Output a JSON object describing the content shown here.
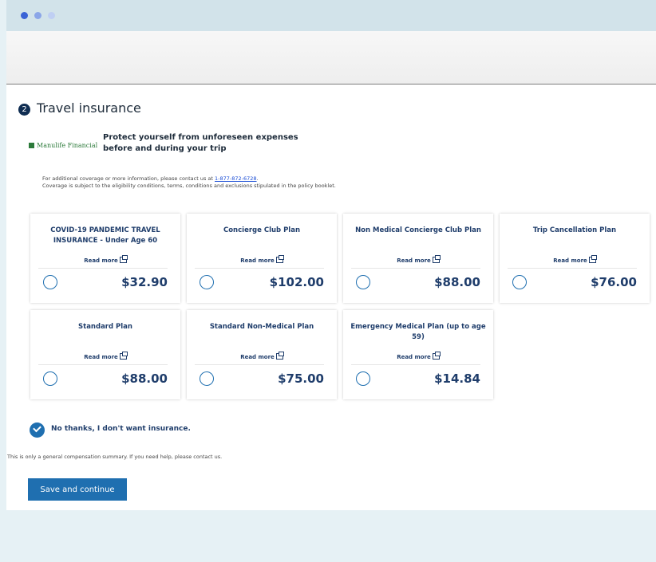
{
  "window": {
    "controls": [
      "close",
      "minimize",
      "zoom"
    ]
  },
  "section": {
    "step_number": "2",
    "title": "Travel insurance"
  },
  "provider": {
    "logo_text": "Manulife Financial",
    "tagline": "Protect yourself from unforeseen expenses before and during your trip"
  },
  "info": {
    "line1_prefix": "For additional coverage or more information, please contact us at ",
    "phone": "1-877-872-6728",
    "line1_suffix": ".",
    "line2": "Coverage is subject to the eligibility conditions, terms, conditions and exclusions stipulated in the policy booklet."
  },
  "plans": [
    {
      "title": "COVID-19 PANDEMIC TRAVEL INSURANCE - Under Age 60",
      "read_more": "Read more",
      "price": "$32.90"
    },
    {
      "title": "Concierge Club Plan",
      "read_more": "Read more",
      "price": "$102.00"
    },
    {
      "title": "Non Medical Concierge Club Plan",
      "read_more": "Read more",
      "price": "$88.00"
    },
    {
      "title": "Trip Cancellation Plan",
      "read_more": "Read more",
      "price": "$76.00"
    },
    {
      "title": "Standard Plan",
      "read_more": "Read more",
      "price": "$88.00"
    },
    {
      "title": "Standard Non-Medical Plan",
      "read_more": "Read more",
      "price": "$75.00"
    },
    {
      "title": "Emergency Medical Plan (up to age 59)",
      "read_more": "Read more",
      "price": "$14.84"
    }
  ],
  "no_thanks": {
    "label": "No thanks, I don't want insurance.",
    "checked": true
  },
  "summary_note": "This is only a general compensation summary. If you need help, please contact us.",
  "actions": {
    "save_label": "Save and continue"
  },
  "colors": {
    "accent": "#1f6fb0",
    "title_blue": "#1f3d6b",
    "step_badge": "#0f2d52",
    "logo_green": "#2c7a3a"
  },
  "icons": [
    "external-link-icon",
    "check-icon"
  ]
}
